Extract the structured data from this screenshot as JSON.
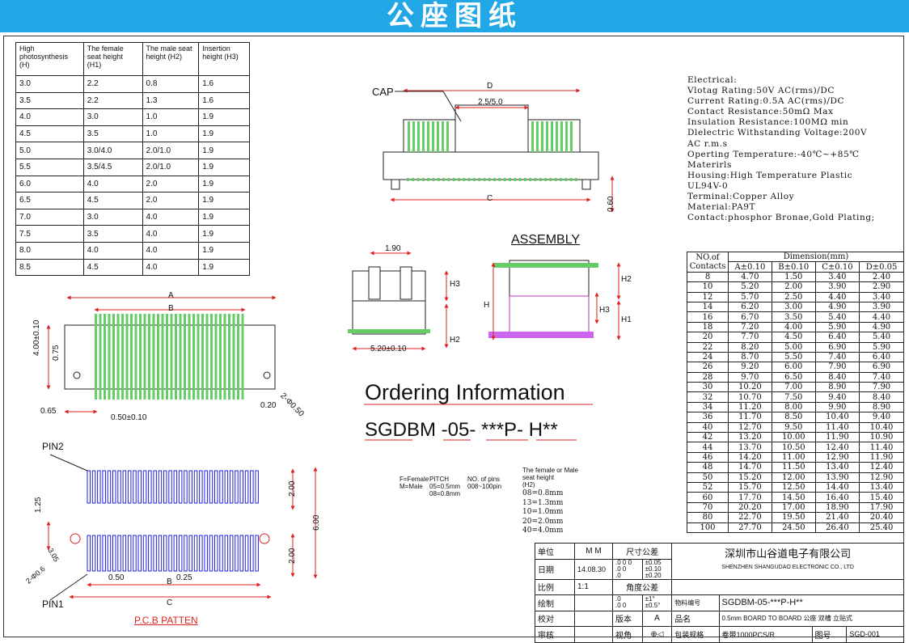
{
  "title": "公座图纸",
  "height_table": {
    "headers": [
      "High photosynthesis (H)",
      "The female seat height (H1)",
      "The male seat height (H2)",
      "Insertion height (H3)"
    ],
    "rows": [
      [
        "3.0",
        "2.2",
        "0.8",
        "1.6"
      ],
      [
        "3.5",
        "2.2",
        "1.3",
        "1.6"
      ],
      [
        "4.0",
        "3.0",
        "1.0",
        "1.9"
      ],
      [
        "4.5",
        "3.5",
        "1.0",
        "1.9"
      ],
      [
        "5.0",
        "3.0/4.0",
        "2.0/1.0",
        "1.9"
      ],
      [
        "5.5",
        "3.5/4.5",
        "2.0/1.0",
        "1.9"
      ],
      [
        "6.0",
        "4.0",
        "2.0",
        "1.9"
      ],
      [
        "6.5",
        "4.5",
        "2.0",
        "1.9"
      ],
      [
        "7.0",
        "3.0",
        "4.0",
        "1.9"
      ],
      [
        "7.5",
        "3.5",
        "4.0",
        "1.9"
      ],
      [
        "8.0",
        "4.0",
        "4.0",
        "1.9"
      ],
      [
        "8.5",
        "4.5",
        "4.0",
        "1.9"
      ]
    ]
  },
  "specs": [
    "Electrical:",
    "Vlotag Rating:50V AC(rms)/DC",
    "Current Rating:0.5A AC(rms)/DC",
    "Contact Resistance:50mΩ Max",
    "Insulation Resistance:100MΩ min",
    "Dlelectric Withstanding Voltage:200V",
    "AC r.m.s",
    "Operting Temperature:-40℃~+85℃",
    "Materirls",
    "Housing:High Temperature Plastic",
    "UL94V-0",
    "Terminal:Copper Alloy",
    "Material:PA9T",
    "Contact:phosphor Bronae,Gold Plating;"
  ],
  "dimension_table": {
    "title": "Dimension(mm)",
    "col0": "NO.of Contacts",
    "headers": [
      "A±0.10",
      "B±0.10",
      "C±0.10",
      "D±0.05"
    ],
    "rows": [
      [
        "8",
        "4.70",
        "1.50",
        "3.40",
        "2.40"
      ],
      [
        "10",
        "5.20",
        "2.00",
        "3.90",
        "2.90"
      ],
      [
        "12",
        "5.70",
        "2.50",
        "4.40",
        "3.40"
      ],
      [
        "14",
        "6.20",
        "3.00",
        "4.90",
        "3.90"
      ],
      [
        "16",
        "6.70",
        "3.50",
        "5.40",
        "4.40"
      ],
      [
        "18",
        "7.20",
        "4.00",
        "5.90",
        "4.90"
      ],
      [
        "20",
        "7.70",
        "4.50",
        "6.40",
        "5.40"
      ],
      [
        "22",
        "8.20",
        "5.00",
        "6.90",
        "5.90"
      ],
      [
        "24",
        "8.70",
        "5.50",
        "7.40",
        "6.40"
      ],
      [
        "26",
        "9.20",
        "6.00",
        "7.90",
        "6.90"
      ],
      [
        "28",
        "9.70",
        "6.50",
        "8.40",
        "7.40"
      ],
      [
        "30",
        "10.20",
        "7.00",
        "8.90",
        "7.90"
      ],
      [
        "32",
        "10.70",
        "7.50",
        "9.40",
        "8.40"
      ],
      [
        "34",
        "11.20",
        "8.00",
        "9.90",
        "8.90"
      ],
      [
        "36",
        "11.70",
        "8.50",
        "10.40",
        "9.40"
      ],
      [
        "40",
        "12.70",
        "9.50",
        "11.40",
        "10.40"
      ],
      [
        "42",
        "13.20",
        "10.00",
        "11.90",
        "10.90"
      ],
      [
        "44",
        "13.70",
        "10.50",
        "12.40",
        "11.40"
      ],
      [
        "46",
        "14.20",
        "11.00",
        "12.90",
        "11.90"
      ],
      [
        "48",
        "14.70",
        "11.50",
        "13.40",
        "12.40"
      ],
      [
        "50",
        "15.20",
        "12.00",
        "13.90",
        "12.90"
      ],
      [
        "52",
        "15.70",
        "12.50",
        "14.40",
        "13.40"
      ],
      [
        "60",
        "17.70",
        "14.50",
        "16.40",
        "15.40"
      ],
      [
        "70",
        "20.20",
        "17.00",
        "18.90",
        "17.90"
      ],
      [
        "80",
        "22.70",
        "19.50",
        "21.40",
        "20.40"
      ],
      [
        "100",
        "27.70",
        "24.50",
        "26.40",
        "25.40"
      ]
    ]
  },
  "drawing_labels": {
    "cap": "CAP",
    "d": "D",
    "pitch": "2.5/5.0",
    "c": "C",
    "h060": "0.60",
    "assembly": "ASSEMBLY",
    "w190": "1.90",
    "w520": "5.20±0.10",
    "h": "H",
    "h1": "H1",
    "h2": "H2",
    "h3": "H3",
    "a": "A",
    "b": "B",
    "v400": "4.00±0.10",
    "v075": "0.75",
    "v065": "0.65",
    "v050": "0.50±0.10",
    "v020": "0.20",
    "dia050": "2-Φ0.50",
    "pin1": "PIN1",
    "pin2": "PIN2",
    "p125": "1.25",
    "p200a": "2.00",
    "p200b": "2.00",
    "p600": "6.00",
    "p050": "0.50",
    "p025": "0.25",
    "p305": "3.05",
    "dia06": "2-Φ0.6",
    "pcb": "P.C.B PATTEN"
  },
  "ordering": {
    "heading": "Ordering Information",
    "code": "SGDBM -05- ***P- H**",
    "n1": "F=Female\nM=Male",
    "n2": "PITCH\n05=0.5mm\n08=0.8mm",
    "n3": "NO. of pins\n008~100pin",
    "n4": "The female or Male\nseat height\n(H2)",
    "n5": "08=0.8mm\n13=1.3mm\n10=1.0mm\n20=2.0mm\n40=4.0mm"
  },
  "title_block": {
    "unit_label": "单位",
    "unit": "M M",
    "tol_label": "尺寸公差",
    "date_label": "日期",
    "date": "14.08.30",
    "tol1a": ".0 0 0\n.0 0\n.0",
    "tol1b": "±0.05\n±0.10\n±0.20",
    "scale_label": "比例",
    "scale": "1:1",
    "angle_label": "角度公差",
    "draw_label": "绘制",
    "tol2a": ".0\n.0 0",
    "tol2b": "±1°\n±0.5°",
    "part_no_label": "物料编号",
    "part_no": "SGDBM-05-***P-H**",
    "check_label": "校对",
    "ver_label": "版本",
    "ver": "A",
    "name_label": "品名",
    "name": "0.5mm BOARD TO BOARD 公座 双槽 立贴式",
    "approve_label": "审核",
    "view_label": "视角",
    "pack_label": "包装规格",
    "pack": "卷带1000PCS/R",
    "dwg_label": "图号",
    "dwg": "SGD-001",
    "company_cn": "深圳市山谷道电子有限公司",
    "company_en": "SHENZHEN SHANGUDAO ELECTRONIC CO., LTD"
  }
}
